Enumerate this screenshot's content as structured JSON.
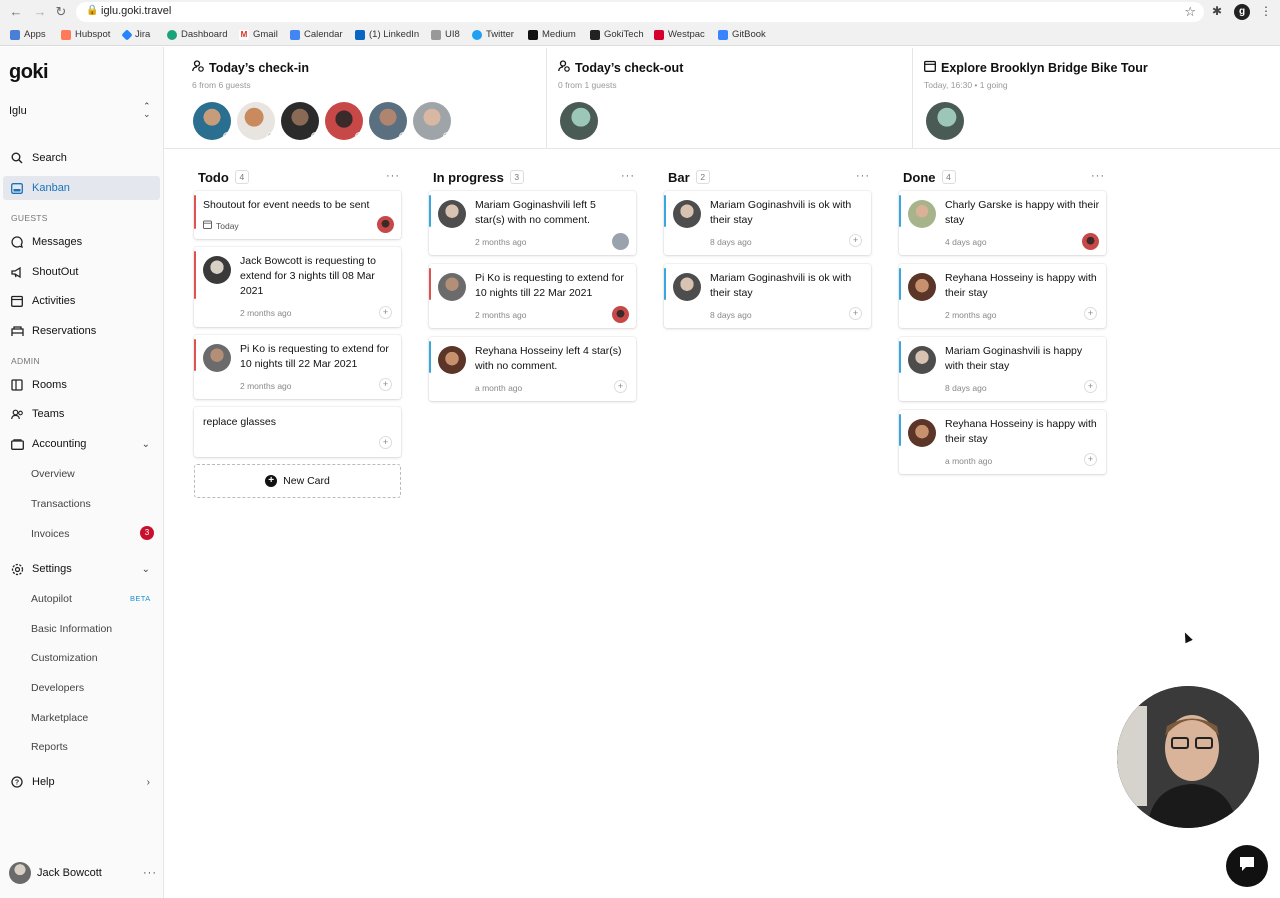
{
  "browser": {
    "url": "iglu.goki.travel",
    "bookmarks": [
      "Apps",
      "Hubspot",
      "Jira",
      "Dashboard",
      "Gmail",
      "Calendar",
      "(1) LinkedIn",
      "UI8",
      "Twitter",
      "Medium",
      "GokiTech",
      "Westpac",
      "GitBook"
    ]
  },
  "sidebar": {
    "logo": "goki",
    "org": "Iglu",
    "search": "Search",
    "kanban": "Kanban",
    "guests_label": "GUESTS",
    "messages": "Messages",
    "shoutout": "ShoutOut",
    "activities": "Activities",
    "reservations": "Reservations",
    "admin_label": "ADMIN",
    "rooms": "Rooms",
    "teams": "Teams",
    "accounting": "Accounting",
    "overview": "Overview",
    "transactions": "Transactions",
    "invoices": "Invoices",
    "invoices_badge": "3",
    "settings": "Settings",
    "autopilot": "Autopilot",
    "beta": "BETA",
    "basic_information": "Basic Information",
    "customization": "Customization",
    "developers": "Developers",
    "marketplace": "Marketplace",
    "reports": "Reports",
    "help": "Help",
    "user_name": "Jack Bowcott"
  },
  "panels": [
    {
      "title": "Today’s check-in",
      "subtitle": "6 from 6 guests"
    },
    {
      "title": "Today’s check-out",
      "subtitle": "0 from 1 guests"
    },
    {
      "title": "Explore Brooklyn Bridge Bike Tour",
      "subtitle": "Today, 16:30 • 1 going"
    }
  ],
  "columns": [
    {
      "title": "Todo",
      "count": "4",
      "cards": [
        {
          "text": "Shoutout for event needs to be sent",
          "time": "Today"
        },
        {
          "text": "Jack Bowcott is requesting to extend for 3 nights till 08 Mar 2021",
          "time": "2 months ago"
        },
        {
          "text": "Pi Ko is requesting to extend for 10 nights till 22 Mar 2021",
          "time": "2 months ago"
        },
        {
          "text": "replace glasses",
          "time": ""
        }
      ]
    },
    {
      "title": "In progress",
      "count": "3",
      "cards": [
        {
          "text": "Mariam Goginashvili left 5 star(s) with no comment.",
          "time": "2 months ago"
        },
        {
          "text": "Pi Ko is requesting to extend for 10 nights till 22 Mar 2021",
          "time": "2 months ago"
        },
        {
          "text": "Reyhana Hosseiny left 4 star(s) with no comment.",
          "time": "a month ago"
        }
      ]
    },
    {
      "title": "Bar",
      "count": "2",
      "cards": [
        {
          "text": "Mariam Goginashvili is ok with their stay",
          "time": "8 days ago"
        },
        {
          "text": "Mariam Goginashvili is ok with their stay",
          "time": "8 days ago"
        }
      ]
    },
    {
      "title": "Done",
      "count": "4",
      "cards": [
        {
          "text": "Charly Garske is happy with their stay",
          "time": "4 days ago"
        },
        {
          "text": "Reyhana Hosseiny is happy with their stay",
          "time": "2 months ago"
        },
        {
          "text": "Mariam Goginashvili is happy with their stay",
          "time": "8 days ago"
        },
        {
          "text": "Reyhana Hosseiny is happy with their stay",
          "time": "a month ago"
        }
      ]
    }
  ],
  "new_card": "New Card",
  "colors": {
    "accent": "#1a73b8",
    "urgent": "#e05252",
    "info": "#3aa6e0",
    "badge": "#c8102e"
  },
  "icons": [
    "search-icon",
    "kanban-icon",
    "messages-icon",
    "shoutout-icon",
    "activities-icon",
    "reservations-icon",
    "rooms-icon",
    "teams-icon",
    "accounting-icon",
    "settings-icon",
    "help-icon",
    "calendar-icon",
    "person-icon",
    "chat-icon"
  ]
}
